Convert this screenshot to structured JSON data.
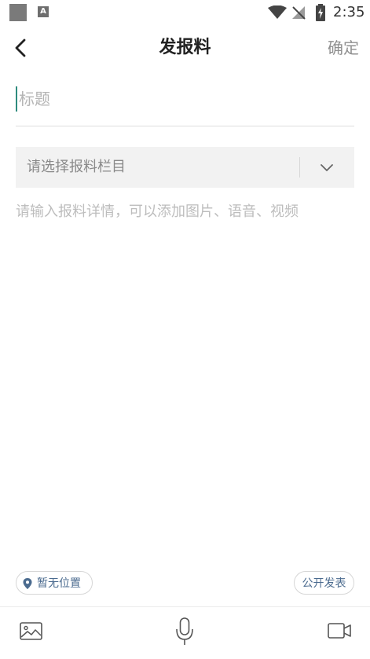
{
  "status_bar": {
    "time": "2:35",
    "a_badge": "A",
    "icons": [
      "notification-square-icon",
      "a-badge-icon",
      "wifi-icon",
      "no-signal-icon",
      "battery-charging-icon"
    ]
  },
  "header": {
    "title": "发报料",
    "confirm_label": "确定",
    "back_icon": "chevron-left-icon"
  },
  "form": {
    "title_placeholder": "标题",
    "category_placeholder": "请选择报料栏目",
    "detail_placeholder": "请输入报料详情，可以添加图片、语音、视频"
  },
  "footer": {
    "location_label": "暂无位置",
    "publish_label": "公开发表"
  },
  "toolbar": {
    "icons": [
      "image-icon",
      "microphone-icon",
      "video-camera-icon"
    ]
  },
  "colors": {
    "accent_cursor": "#2e8b7e",
    "pill_text": "#4b6b8f",
    "confirm_text": "#8f8f8f"
  }
}
